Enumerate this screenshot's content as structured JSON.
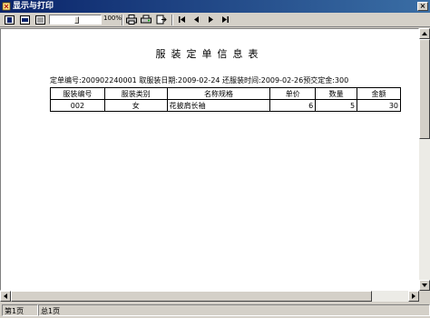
{
  "window": {
    "title": "显示与打印",
    "close_label": "×"
  },
  "toolbar": {
    "zoom_label": "100%",
    "zoom_value": 0.55,
    "buttons": [
      "fit-page-icon",
      "fit-width-icon",
      "actual-size-icon",
      "print-icon",
      "print-setup-icon",
      "export-icon",
      "first-page-icon",
      "prev-page-icon",
      "next-page-icon",
      "last-page-icon"
    ]
  },
  "report": {
    "title": "服装定单信息表",
    "info_line": "定单编号:200902240001  取服装日期:2009-02-24  还服装时间:2009-02-26预交定金:300",
    "columns": [
      "服装编号",
      "服装类别",
      "名称规格",
      "单价",
      "数量",
      "金额"
    ],
    "rows": [
      [
        "002",
        "女",
        "花披肩长袖",
        "6",
        "5",
        "30"
      ]
    ]
  },
  "status": {
    "page": "第1页",
    "total": "总1页"
  },
  "colors": {
    "titlebar_start": "#0a246a",
    "titlebar_end": "#3a6ea5",
    "face": "#d4d0c8"
  }
}
